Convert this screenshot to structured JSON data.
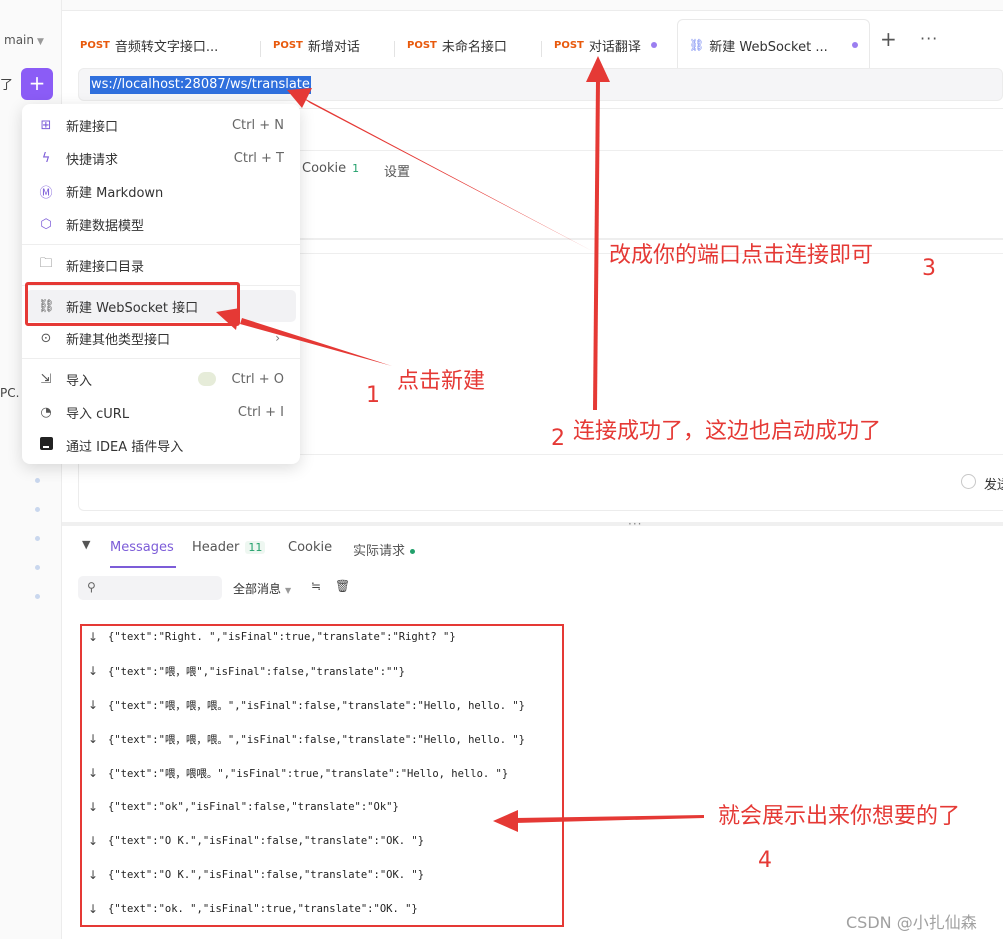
{
  "sidebar": {
    "branch": "main",
    "partial_text": "了",
    "partial_text_2": "PC."
  },
  "tabs": [
    {
      "method": "POST",
      "label": "音频转文字接口..."
    },
    {
      "method": "POST",
      "label": "新增对话"
    },
    {
      "method": "POST",
      "label": "未命名接口"
    },
    {
      "method": "POST",
      "label": "对话翻译",
      "unsaved": true
    },
    {
      "label": "新建 WebSocket ...",
      "active": true,
      "unsaved": true
    }
  ],
  "url": "ws://localhost:28087/ws/translate",
  "request_tabs": {
    "cookie_label": "Cookie",
    "cookie_count": "1",
    "settings_label": "设置"
  },
  "send_option_label": "发送",
  "menu": {
    "items": [
      {
        "icon": "api-icon",
        "label": "新建接口",
        "shortcut": "Ctrl + N"
      },
      {
        "icon": "lightning-icon",
        "label": "快捷请求",
        "shortcut": "Ctrl + T"
      },
      {
        "icon": "markdown-icon",
        "label": "新建 Markdown",
        "shortcut": ""
      },
      {
        "icon": "cube-icon",
        "label": "新建数据模型",
        "shortcut": ""
      },
      {
        "icon": "folder-plus-icon",
        "label": "新建接口目录",
        "shortcut": ""
      },
      {
        "icon": "websocket-icon",
        "label": "新建 WebSocket 接口",
        "shortcut": ""
      },
      {
        "icon": "more-circle-icon",
        "label": "新建其他类型接口",
        "shortcut": ""
      },
      {
        "icon": "import-icon",
        "label": "导入",
        "shortcut": "Ctrl + O"
      },
      {
        "icon": "curl-icon",
        "label": "导入 cURL",
        "shortcut": "Ctrl + I"
      },
      {
        "icon": "idea-icon",
        "label": "通过 IDEA 插件导入",
        "shortcut": ""
      }
    ]
  },
  "messages_panel": {
    "tabs": [
      {
        "label": "Messages",
        "active": true
      },
      {
        "label": "Header",
        "count": "11"
      },
      {
        "label": "Cookie"
      },
      {
        "label": "实际请求"
      }
    ],
    "filter_label": "全部消息",
    "messages": [
      "{\"text\":\"Right. \",\"isFinal\":true,\"translate\":\"Right? \"}",
      "{\"text\":\"喂，喂\",\"isFinal\":false,\"translate\":\"\"}",
      "{\"text\":\"喂，喂，喂。\",\"isFinal\":false,\"translate\":\"Hello, hello. \"}",
      "{\"text\":\"喂，喂，喂。\",\"isFinal\":false,\"translate\":\"Hello, hello. \"}",
      "{\"text\":\"喂，喂喂。\",\"isFinal\":true,\"translate\":\"Hello, hello. \"}",
      "{\"text\":\"ok\",\"isFinal\":false,\"translate\":\"Ok\"}",
      "{\"text\":\"O K.\",\"isFinal\":false,\"translate\":\"OK. \"}",
      "{\"text\":\"O K.\",\"isFinal\":false,\"translate\":\"OK. \"}",
      "{\"text\":\"ok. \",\"isFinal\":true,\"translate\":\"OK. \"}"
    ]
  },
  "annotations": {
    "a1_text": "点击新建",
    "a1_num": "1",
    "a2_text": "连接成功了，这边也启动成功了",
    "a2_num": "2",
    "a3_text": "改成你的端口点击连接即可",
    "a3_num": "3",
    "a4_text": "就会展示出来你想要的了",
    "a4_num": "4"
  },
  "watermark": "CSDN @小扎仙森",
  "colors": {
    "accent": "#8b5cf6",
    "method": "#e8590c",
    "annotation": "#e53935",
    "selection": "#2f6fdd"
  }
}
